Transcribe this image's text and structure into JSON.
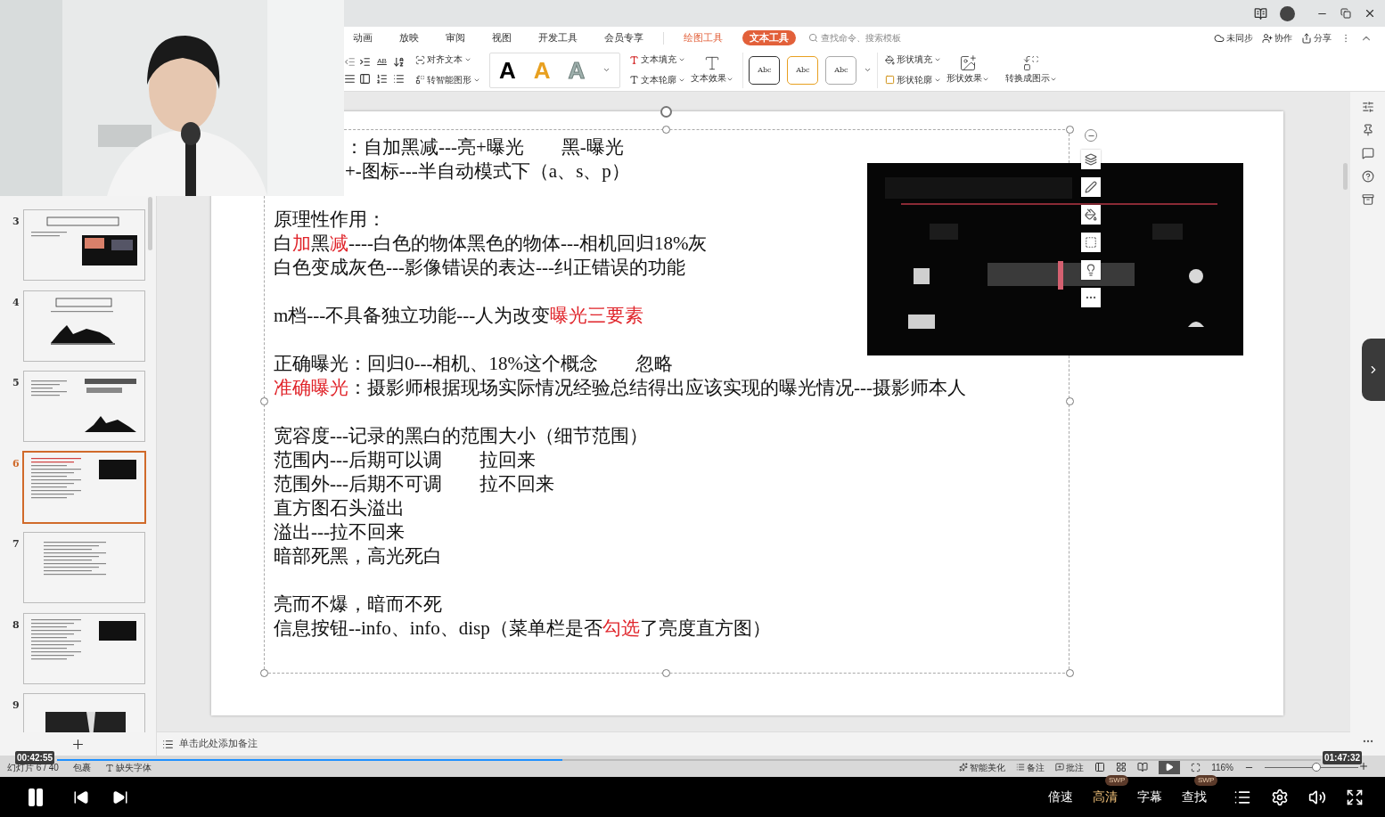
{
  "ribbon": {
    "tabs": [
      {
        "label": "动画",
        "selected": false,
        "contextual": false
      },
      {
        "label": "放映",
        "selected": false,
        "contextual": false
      },
      {
        "label": "审阅",
        "selected": false,
        "contextual": false
      },
      {
        "label": "视图",
        "selected": false,
        "contextual": false
      },
      {
        "label": "开发工具",
        "selected": false,
        "contextual": false
      },
      {
        "label": "会员专享",
        "selected": false,
        "contextual": false
      },
      {
        "label": "绘图工具",
        "selected": false,
        "contextual": true
      },
      {
        "label": "文本工具",
        "selected": true,
        "contextual": true
      }
    ],
    "search": {
      "placeholder": "查找命令、搜索模板"
    },
    "actions": [
      "未同步",
      "协作",
      "分享"
    ]
  },
  "toolbar": {
    "ab": "AB",
    "align_text": "对齐文本",
    "smart_shape": "转智能图形",
    "letter_styles": [
      {
        "label": "A",
        "kind": "solid",
        "color": "#000000"
      },
      {
        "label": "A",
        "kind": "solid",
        "color": "#e8a020"
      },
      {
        "label": "A",
        "kind": "outline",
        "color": "#9fb0ad"
      }
    ],
    "text_fill": "文本填充",
    "text_outline": "文本轮廓",
    "text_effect": "文本效果",
    "shape_styles": [
      {
        "label": "Abc",
        "color": "#333333"
      },
      {
        "label": "Abc",
        "color": "#e8a020"
      },
      {
        "label": "Abc",
        "color": "#aaaaaa"
      }
    ],
    "shape_fill": "形状填充",
    "shape_outline": "形状轮廓",
    "shape_effect": "形状效果",
    "convert": "转换成图示"
  },
  "thumbnails": [
    {
      "number": "3",
      "kind": "title-photo",
      "selected": false
    },
    {
      "number": "4",
      "kind": "title-chart",
      "selected": false
    },
    {
      "number": "5",
      "kind": "text-chart",
      "selected": false
    },
    {
      "number": "6",
      "kind": "text-photo",
      "selected": true
    },
    {
      "number": "7",
      "kind": "text",
      "selected": false
    },
    {
      "number": "8",
      "kind": "text-photo",
      "selected": false
    },
    {
      "number": "9",
      "selected": false
    }
  ],
  "slide": {
    "paragraphs": [
      [
        [
          {
            "text": "：自加黑减---亮+曝光　　黑-曝光",
            "highlight": false
          }
        ],
        [
          {
            "text": "+-图标---半自动模式下（a、s、p）",
            "highlight": false
          }
        ]
      ],
      [
        [
          {
            "text": "原理性作用：",
            "highlight": false
          }
        ],
        [
          {
            "text": "白",
            "highlight": false
          },
          {
            "text": "加",
            "highlight": true
          },
          {
            "text": "黑",
            "highlight": false
          },
          {
            "text": "减",
            "highlight": true
          },
          {
            "text": "----白色的物体黑色的物体---相机回归18%灰",
            "highlight": false
          }
        ],
        [
          {
            "text": "白色变成灰色---影像错误的表达---纠正错误的功能",
            "highlight": false
          }
        ]
      ],
      [
        [
          {
            "text": "m档---不具备独立功能---人为改变",
            "highlight": false
          },
          {
            "text": "曝光三要素",
            "highlight": true
          }
        ]
      ],
      [
        [
          {
            "text": "正确曝光：回归0---相机、18%这个概念　　忽略",
            "highlight": false
          }
        ],
        [
          {
            "text": "准确曝光",
            "highlight": true
          },
          {
            "text": "：摄影师根据现场实际情况经验总结得出应该实现的曝光情况---摄影师本人",
            "highlight": false
          }
        ]
      ],
      [
        [
          {
            "text": "宽容度---记录的黑白的范围大小（细节范围）",
            "highlight": false
          }
        ],
        [
          {
            "text": "范围内---后期可以调　　拉回来",
            "highlight": false
          }
        ],
        [
          {
            "text": "范围外---后期不可调　　拉不回来",
            "highlight": false
          }
        ],
        [
          {
            "text": "直方图石头溢出",
            "highlight": false
          }
        ],
        [
          {
            "text": "溢出---拉不回来",
            "highlight": false
          }
        ],
        [
          {
            "text": "暗部死黑，高光死白",
            "highlight": false
          }
        ]
      ],
      [
        [
          {
            "text": "亮而不爆，暗而不死",
            "highlight": false
          }
        ],
        [
          {
            "text": "信息按钮--info、info、disp（菜单栏是否",
            "highlight": false
          },
          {
            "text": "勾选",
            "highlight": true
          },
          {
            "text": "了亮度直方图）",
            "highlight": false
          }
        ]
      ]
    ]
  },
  "notes": {
    "placeholder": "单击此处添加备注"
  },
  "status": {
    "slide": "幻灯片 6 / 40",
    "items": [
      "包裹",
      "缺失字体"
    ],
    "beautify": "智能美化",
    "notes": "备注",
    "comments": "批注",
    "zoom": "116%",
    "zoom_slider": {
      "level": 0.55
    }
  },
  "player": {
    "elapsed": "00:42:55",
    "duration": "01:47:32",
    "progress": {
      "level": 0.4
    },
    "options": [
      {
        "label": "倍速",
        "active": false
      },
      {
        "label": "高清",
        "active": true,
        "badge": "SWP"
      },
      {
        "label": "字幕",
        "active": false
      },
      {
        "label": "查找",
        "active": false,
        "badge": "SWP"
      }
    ]
  }
}
